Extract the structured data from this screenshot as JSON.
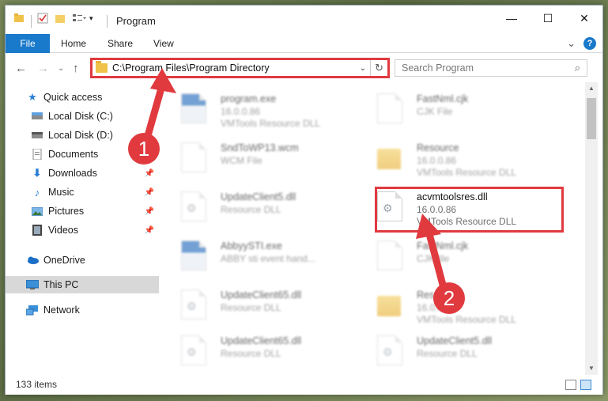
{
  "window": {
    "title": "Program",
    "controls": {
      "minimize": "—",
      "maximize": "☐",
      "close": "✕"
    }
  },
  "ribbon": {
    "tabs": [
      "File",
      "Home",
      "Share",
      "View"
    ],
    "help": "?",
    "expand": "⌄"
  },
  "address": {
    "path": "C:\\Program Files\\Program Directory",
    "search_placeholder": "Search Program"
  },
  "sidebar": {
    "items": [
      {
        "label": "Quick access",
        "icon": "star-icon"
      },
      {
        "label": "Local Disk (C:)",
        "icon": "drive-icon"
      },
      {
        "label": "Local Disk (D:)",
        "icon": "drive-icon"
      },
      {
        "label": "Documents",
        "icon": "documents-icon"
      },
      {
        "label": "Downloads",
        "icon": "download-icon"
      },
      {
        "label": "Music",
        "icon": "music-icon"
      },
      {
        "label": "Pictures",
        "icon": "pictures-icon"
      },
      {
        "label": "Videos",
        "icon": "videos-icon"
      },
      {
        "label": "OneDrive",
        "icon": "cloud-icon"
      },
      {
        "label": "This PC",
        "icon": "computer-icon"
      },
      {
        "label": "Network",
        "icon": "network-icon"
      }
    ]
  },
  "files": [
    {
      "name": "program.exe",
      "line2": "16.0.0.86",
      "line3": "VMTools Resource DLL",
      "kind": "exe"
    },
    {
      "name": "FastNml.cjk",
      "line2": "CJK File",
      "line3": "",
      "kind": "doc"
    },
    {
      "name": "SndToWP13.wcm",
      "line2": "WCM File",
      "line3": "",
      "kind": "doc"
    },
    {
      "name": "Resource",
      "line2": "16.0.0.86",
      "line3": "VMTools Resource DLL",
      "kind": "folder"
    },
    {
      "name": "UpdateClient5.dll",
      "line2": "Resource DLL",
      "line3": "",
      "kind": "dll"
    },
    {
      "name": "acvmtoolsres.dll",
      "line2": "16.0.0.86",
      "line3": "VMTools Resource DLL",
      "kind": "dll"
    },
    {
      "name": "AbbyySTI.exe",
      "line2": "ABBY sti event hand...",
      "line3": "",
      "kind": "exe"
    },
    {
      "name": "FastNml.cjk",
      "line2": "CJK file",
      "line3": "",
      "kind": "doc"
    },
    {
      "name": "UpdateClient65.dll",
      "line2": "Resource DLL",
      "line3": "",
      "kind": "dll"
    },
    {
      "name": "Resource",
      "line2": "16.0.0.86",
      "line3": "VMTools Resource DLL",
      "kind": "folder"
    },
    {
      "name": "UpdateClient65.dll",
      "line2": "Resource DLL",
      "line3": "",
      "kind": "dll"
    },
    {
      "name": "UpdateClient5.dll",
      "line2": "Resource DLL",
      "line3": "",
      "kind": "dll"
    }
  ],
  "status": {
    "count": "133 items"
  },
  "annotations": {
    "step1": "1",
    "step2": "2",
    "accent": "#e03a3f"
  }
}
